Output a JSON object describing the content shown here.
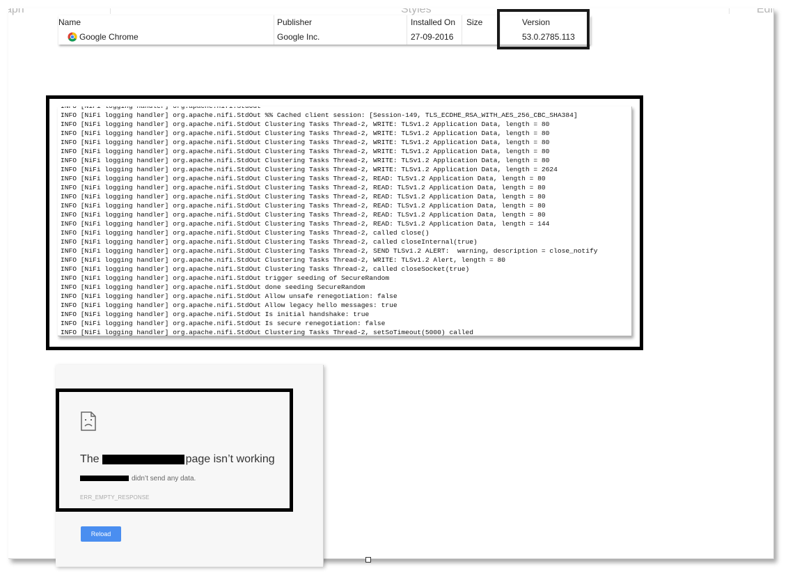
{
  "ribbon": {
    "left_fragment": "aph",
    "center_fragment": "Styles",
    "right_fragment": "Edit"
  },
  "programs": {
    "columns": [
      "Name",
      "Publisher",
      "Installed On",
      "Size",
      "Version"
    ],
    "rows": [
      {
        "name": "Google Chrome",
        "publisher": "Google Inc.",
        "installed_on": "27-09-2016",
        "size": "",
        "version": "53.0.2785.113",
        "icon": "chrome-icon"
      }
    ]
  },
  "log": {
    "lines": [
      "INFO [NiFi logging handler] org.apache.nifi.StdOut",
      "INFO [NiFi logging handler] org.apache.nifi.StdOut %% Cached client session: [Session-149, TLS_ECDHE_RSA_WITH_AES_256_CBC_SHA384]",
      "INFO [NiFi logging handler] org.apache.nifi.StdOut Clustering Tasks Thread-2, WRITE: TLSv1.2 Application Data, length = 80",
      "INFO [NiFi logging handler] org.apache.nifi.StdOut Clustering Tasks Thread-2, WRITE: TLSv1.2 Application Data, length = 80",
      "INFO [NiFi logging handler] org.apache.nifi.StdOut Clustering Tasks Thread-2, WRITE: TLSv1.2 Application Data, length = 80",
      "INFO [NiFi logging handler] org.apache.nifi.StdOut Clustering Tasks Thread-2, WRITE: TLSv1.2 Application Data, length = 80",
      "INFO [NiFi logging handler] org.apache.nifi.StdOut Clustering Tasks Thread-2, WRITE: TLSv1.2 Application Data, length = 80",
      "INFO [NiFi logging handler] org.apache.nifi.StdOut Clustering Tasks Thread-2, WRITE: TLSv1.2 Application Data, length = 2624",
      "INFO [NiFi logging handler] org.apache.nifi.StdOut Clustering Tasks Thread-2, READ: TLSv1.2 Application Data, length = 80",
      "INFO [NiFi logging handler] org.apache.nifi.StdOut Clustering Tasks Thread-2, READ: TLSv1.2 Application Data, length = 80",
      "INFO [NiFi logging handler] org.apache.nifi.StdOut Clustering Tasks Thread-2, READ: TLSv1.2 Application Data, length = 80",
      "INFO [NiFi logging handler] org.apache.nifi.StdOut Clustering Tasks Thread-2, READ: TLSv1.2 Application Data, length = 80",
      "INFO [NiFi logging handler] org.apache.nifi.StdOut Clustering Tasks Thread-2, READ: TLSv1.2 Application Data, length = 80",
      "INFO [NiFi logging handler] org.apache.nifi.StdOut Clustering Tasks Thread-2, READ: TLSv1.2 Application Data, length = 144",
      "INFO [NiFi logging handler] org.apache.nifi.StdOut Clustering Tasks Thread-2, called close()",
      "INFO [NiFi logging handler] org.apache.nifi.StdOut Clustering Tasks Thread-2, called closeInternal(true)",
      "INFO [NiFi logging handler] org.apache.nifi.StdOut Clustering Tasks Thread-2, SEND TLSv1.2 ALERT:  warning, description = close_notify",
      "INFO [NiFi logging handler] org.apache.nifi.StdOut Clustering Tasks Thread-2, WRITE: TLSv1.2 Alert, length = 80",
      "INFO [NiFi logging handler] org.apache.nifi.StdOut Clustering Tasks Thread-2, called closeSocket(true)",
      "INFO [NiFi logging handler] org.apache.nifi.StdOut trigger seeding of SecureRandom",
      "INFO [NiFi logging handler] org.apache.nifi.StdOut done seeding SecureRandom",
      "INFO [NiFi logging handler] org.apache.nifi.StdOut Allow unsafe renegotiation: false",
      "INFO [NiFi logging handler] org.apache.nifi.StdOut Allow legacy hello messages: true",
      "INFO [NiFi logging handler] org.apache.nifi.StdOut Is initial handshake: true",
      "INFO [NiFi logging handler] org.apache.nifi.StdOut Is secure renegotiation: false",
      "INFO [NiFi logging handler] org.apache.nifi.StdOut Clustering Tasks Thread-2, setSoTimeout(5000) called"
    ]
  },
  "error_page": {
    "icon": "sad-page-icon",
    "title_prefix": "The",
    "title_suffix": "page isn’t working",
    "message_suffix": "didn’t send any data.",
    "error_code": "ERR_EMPTY_RESPONSE",
    "reload_label": "Reload",
    "button_color": "#4a8ef0"
  }
}
